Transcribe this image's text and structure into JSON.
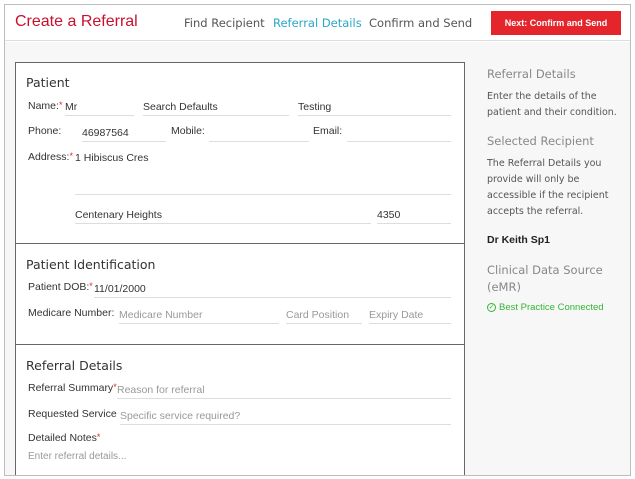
{
  "header": {
    "title": "Create a Referral",
    "nav": [
      "Find Recipient",
      "Referral Details",
      "Confirm and Send"
    ],
    "next_label": "Next: Confirm and Send"
  },
  "patient": {
    "title": "Patient",
    "name_label": "Name:",
    "title_value": "Mr",
    "first_name": "Search Defaults",
    "last_name": "Testing",
    "phone_label": "Phone:",
    "phone_value": "46987564",
    "mobile_label": "Mobile:",
    "email_label": "Email:",
    "address_label": "Address:",
    "address_line1": "1 Hibiscus Cres",
    "suburb": "Centenary Heights",
    "postcode": "4350"
  },
  "identification": {
    "title": "Patient Identification",
    "dob_label": "Patient DOB:",
    "dob_value": "11/01/2000",
    "medicare_label": "Medicare Number:",
    "medicare_placeholder": "Medicare Number",
    "card_position_placeholder": "Card Position",
    "expiry_placeholder": "Expiry Date"
  },
  "referral": {
    "title": "Referral Details",
    "summary_label": "Referral Summary",
    "summary_placeholder": "Reason for referral",
    "service_label": "Requested Service",
    "service_placeholder": "Specific service required?",
    "notes_label": "Detailed Notes",
    "notes_placeholder": "Enter referral details..."
  },
  "sidebar": {
    "details_heading": "Referral Details",
    "details_text": "Enter the details of the patient and their condition.",
    "recipient_heading": "Selected Recipient",
    "recipient_text": "The Referral Details you provide will only be accessible if the recipient accepts the referral.",
    "recipient_name": "Dr Keith Sp1",
    "source_heading": "Clinical Data Source (eMR)",
    "source_status": "Best Practice Connected"
  },
  "colors": {
    "brand_red": "#e4252b",
    "active_tab": "#2aa7c9",
    "connected_green": "#35b535"
  }
}
